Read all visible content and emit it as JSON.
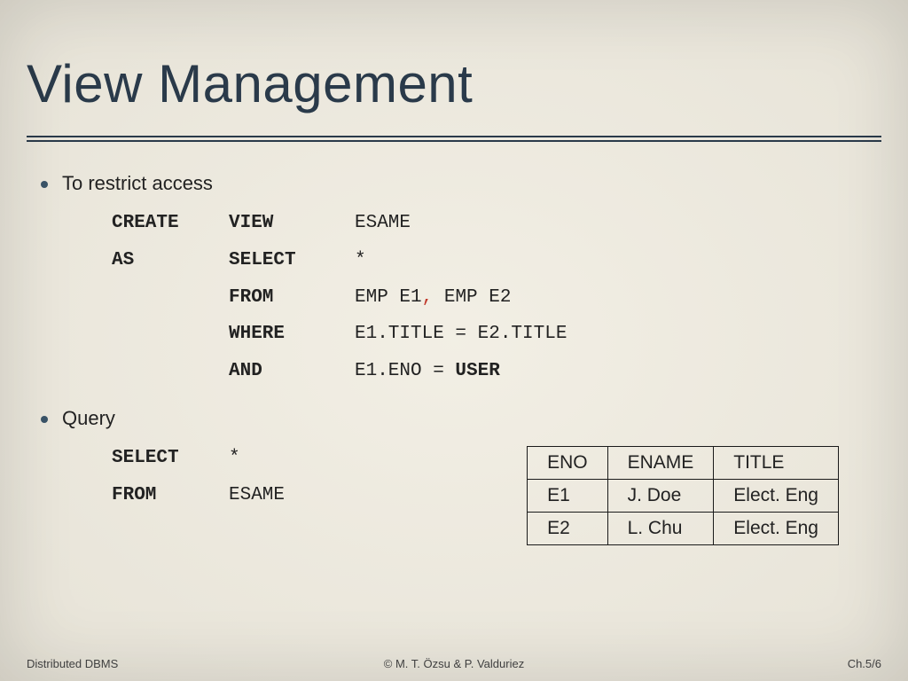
{
  "title": "View Management",
  "bullets": {
    "b1": "To restrict access",
    "b2": "Query"
  },
  "sql1": {
    "r1c1": "CREATE",
    "r1c2": "VIEW",
    "r1c3": "ESAME",
    "r2c1": "AS",
    "r2c2": "SELECT",
    "r2c3": "*",
    "r3c2": "FROM",
    "r3c3a": "EMP E1",
    "r3comma": ",",
    "r3c3b": " EMP E2",
    "r4c2": "WHERE",
    "r4c3": "E1.TITLE = E2.TITLE",
    "r5c2": "AND",
    "r5c3a": "E1.ENO = ",
    "r5user": "USER"
  },
  "sql2": {
    "r1c1": "SELECT",
    "r1c2": "*",
    "r2c1": "FROM",
    "r2c2": "ESAME"
  },
  "table": {
    "h1": "ENO",
    "h2": "ENAME",
    "h3": "TITLE",
    "rows": [
      {
        "c1": "E1",
        "c2": "J. Doe",
        "c3": "Elect. Eng"
      },
      {
        "c1": "E2",
        "c2": "L. Chu",
        "c3": "Elect. Eng"
      }
    ]
  },
  "footer": {
    "left": "Distributed DBMS",
    "center": "© M. T. Özsu & P. Valduriez",
    "right": "Ch.5/6"
  },
  "chart_data": {
    "type": "table",
    "title": "ESAME view result",
    "columns": [
      "ENO",
      "ENAME",
      "TITLE"
    ],
    "rows": [
      [
        "E1",
        "J. Doe",
        "Elect. Eng"
      ],
      [
        "E2",
        "L. Chu",
        "Elect. Eng"
      ]
    ]
  }
}
